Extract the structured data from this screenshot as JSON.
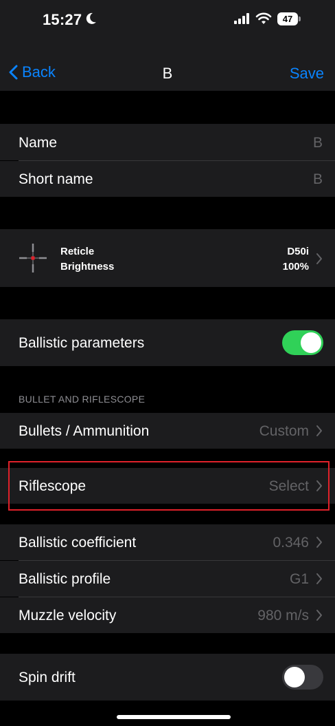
{
  "status_bar": {
    "time": "15:27",
    "battery_level": "47",
    "icons": [
      "moon-icon",
      "signal-icon",
      "wifi-icon",
      "battery-icon"
    ]
  },
  "nav": {
    "back_label": "Back",
    "title": "B",
    "save_label": "Save"
  },
  "profile": {
    "name_label": "Name",
    "name_value": "B",
    "short_name_label": "Short name",
    "short_name_value": "B"
  },
  "reticle": {
    "reticle_label": "Reticle",
    "reticle_value": "D50i",
    "brightness_label": "Brightness",
    "brightness_value": "100%",
    "icon": "reticle-crosshair-icon"
  },
  "ballistic": {
    "label": "Ballistic parameters",
    "enabled": true
  },
  "section": {
    "header": "BULLET AND RIFLESCOPE"
  },
  "bullets": {
    "label": "Bullets / Ammunition",
    "value": "Custom"
  },
  "riflescope": {
    "label": "Riflescope",
    "value": "Select"
  },
  "params": {
    "coefficient_label": "Ballistic coefficient",
    "coefficient_value": "0.346",
    "profile_label": "Ballistic profile",
    "profile_value": "G1",
    "velocity_label": "Muzzle velocity",
    "velocity_value": "980 m/s"
  },
  "spin": {
    "label": "Spin drift",
    "enabled": false
  },
  "colors": {
    "accent": "#0a84ff",
    "toggle_on": "#30d158",
    "toggle_off": "#39393d",
    "highlight": "#e0212a",
    "reticle_dot": "#e0212a"
  }
}
